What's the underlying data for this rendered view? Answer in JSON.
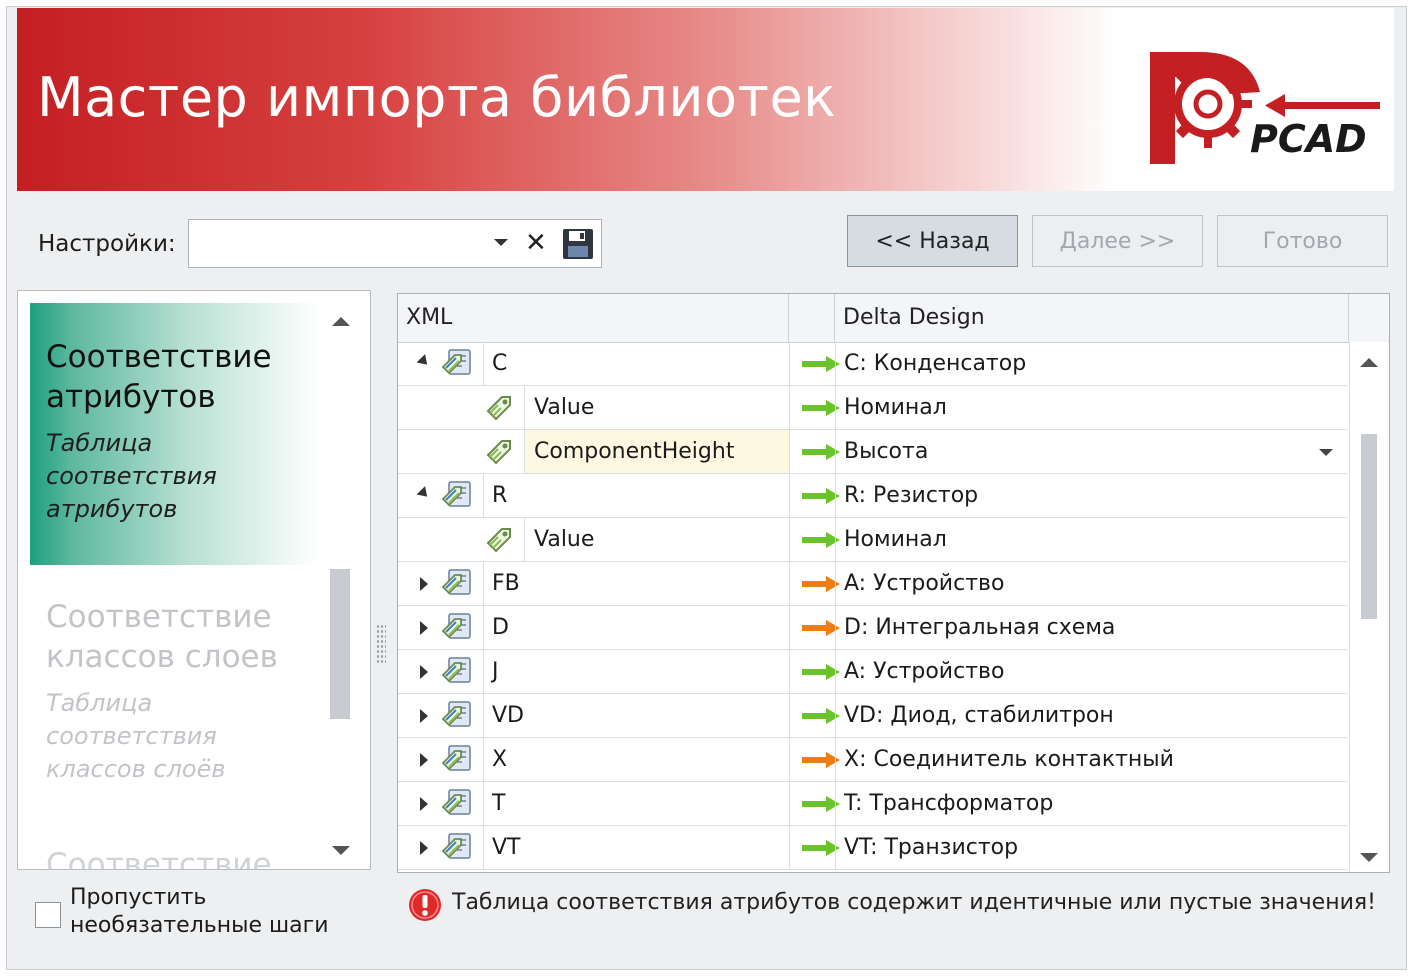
{
  "header": {
    "title": "Мастер импорта библиотек",
    "logo_text": "PCAD"
  },
  "toolbar": {
    "settings_label": "Настройки:",
    "settings_value": "",
    "back_label": "<< Назад",
    "next_label": "Далее >>",
    "done_label": "Готово"
  },
  "steps": [
    {
      "title_line1": "Соответствие",
      "title_line2": "атрибутов",
      "sub_line1": "Таблица",
      "sub_line2": "соответствия",
      "sub_line3": "атрибутов",
      "active": true
    },
    {
      "title_line1": "Соответствие",
      "title_line2": "классов слоев",
      "sub_line1": "Таблица",
      "sub_line2": "соответствия",
      "sub_line3": "классов слоёв",
      "active": false
    },
    {
      "title_line1": "Соответствие",
      "active": false
    }
  ],
  "grid": {
    "columns": {
      "xml": "XML",
      "mapping": "",
      "delta": "Delta Design"
    },
    "rows": [
      {
        "level": 0,
        "expander": "expanded",
        "xml": "C",
        "arrow": "green",
        "delta": "C: Конденсатор"
      },
      {
        "level": 1,
        "expander": "",
        "xml": "Value",
        "arrow": "green",
        "delta": "Номинал"
      },
      {
        "level": 1,
        "expander": "",
        "xml": "ComponentHeight",
        "arrow": "green",
        "delta": "Высота",
        "editing": true
      },
      {
        "level": 0,
        "expander": "expanded",
        "xml": "R",
        "arrow": "green",
        "delta": "R: Резистор"
      },
      {
        "level": 1,
        "expander": "",
        "xml": "Value",
        "arrow": "green",
        "delta": "Номинал"
      },
      {
        "level": 0,
        "expander": "collapsed",
        "xml": "FB",
        "arrow": "orange",
        "delta": "A: Устройство"
      },
      {
        "level": 0,
        "expander": "collapsed",
        "xml": "D",
        "arrow": "orange",
        "delta": "D: Интегральная схема"
      },
      {
        "level": 0,
        "expander": "collapsed",
        "xml": "J",
        "arrow": "green",
        "delta": "A: Устройство"
      },
      {
        "level": 0,
        "expander": "collapsed",
        "xml": "VD",
        "arrow": "green",
        "delta": "VD: Диод, стабилитрон"
      },
      {
        "level": 0,
        "expander": "collapsed",
        "xml": "X",
        "arrow": "orange",
        "delta": "X: Соединитель контактный"
      },
      {
        "level": 0,
        "expander": "collapsed",
        "xml": "T",
        "arrow": "green",
        "delta": "T: Трансформатор"
      },
      {
        "level": 0,
        "expander": "collapsed",
        "xml": "VT",
        "arrow": "green",
        "delta": "VT: Транзистор"
      }
    ]
  },
  "footer": {
    "skip_line1": "Пропустить",
    "skip_line2": "необязательные шаги",
    "skip_checked": false,
    "warning": "Таблица соответствия атрибутов содержит идентичные или пустые значения!"
  },
  "colors": {
    "banner": "#c41f22",
    "accent_active_step": "#1d9f80",
    "arrow_green": "#6cc22a",
    "arrow_orange": "#f07c14",
    "warning": "#e02a2a"
  }
}
